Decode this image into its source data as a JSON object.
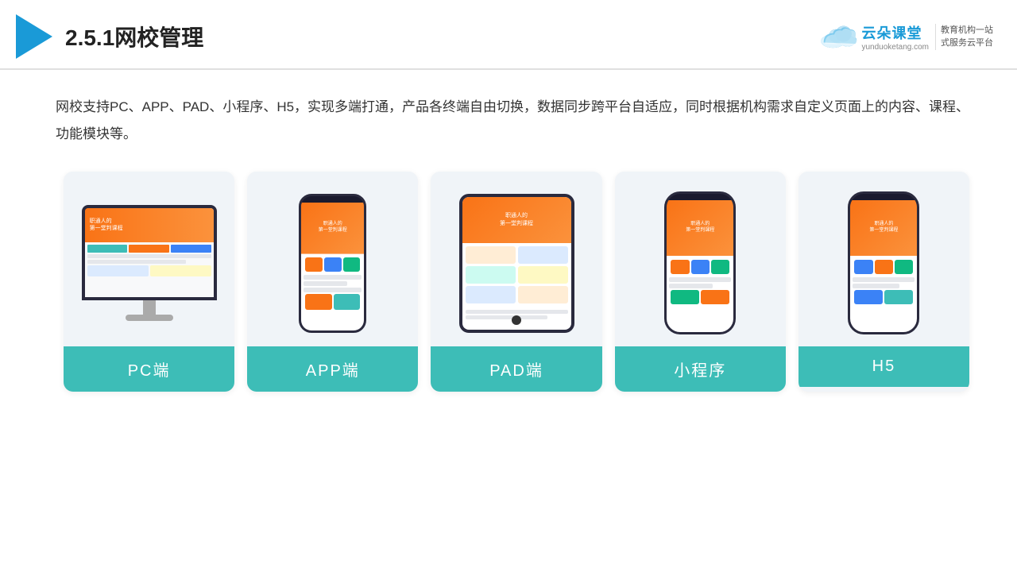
{
  "header": {
    "title": "2.5.1网校管理",
    "brand": {
      "name": "云朵课堂",
      "url": "yunduoketang.com",
      "tagline": "教育机构一站\n式服务云平台"
    }
  },
  "description": "网校支持PC、APP、PAD、小程序、H5，实现多端打通，产品各终端自由切换，数据同步跨平台自适应，同时根据机构需求自定义页面上的内容、课程、功能模块等。",
  "cards": [
    {
      "id": "pc",
      "label": "PC端"
    },
    {
      "id": "app",
      "label": "APP端"
    },
    {
      "id": "pad",
      "label": "PAD端"
    },
    {
      "id": "miniapp",
      "label": "小程序"
    },
    {
      "id": "h5",
      "label": "H5"
    }
  ],
  "colors": {
    "teal": "#3dbdb7",
    "blue": "#1a9ad7",
    "orange": "#f97316"
  }
}
